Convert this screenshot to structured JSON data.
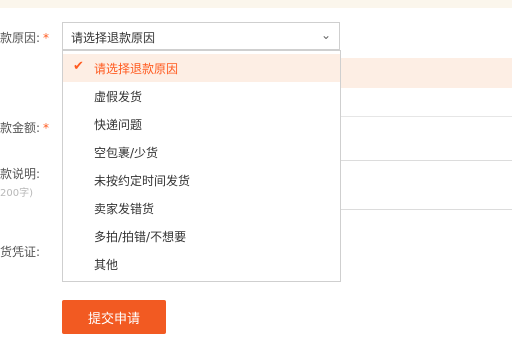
{
  "form": {
    "reason_label": "款原因:",
    "amount_label": "款金额:",
    "desc_label": "款说明:",
    "desc_hint": "200字)",
    "proof_label": "货凭证:",
    "required_mark": "*"
  },
  "select": {
    "value": "请选择退款原因",
    "chevron": "⌄"
  },
  "dropdown": {
    "options": [
      {
        "label": "请选择退款原因",
        "selected": true
      },
      {
        "label": "虚假发货",
        "selected": false
      },
      {
        "label": "快递问题",
        "selected": false
      },
      {
        "label": "空包裹/少货",
        "selected": false
      },
      {
        "label": "未按约定时间发货",
        "selected": false
      },
      {
        "label": "卖家发错货",
        "selected": false
      },
      {
        "label": "多拍/拍错/不想要",
        "selected": false
      },
      {
        "label": "其他",
        "selected": false
      }
    ],
    "check_icon": "✔"
  },
  "submit_label": "提交申请",
  "colors": {
    "accent": "#f25a22",
    "selected_bg": "#fdeee4"
  }
}
